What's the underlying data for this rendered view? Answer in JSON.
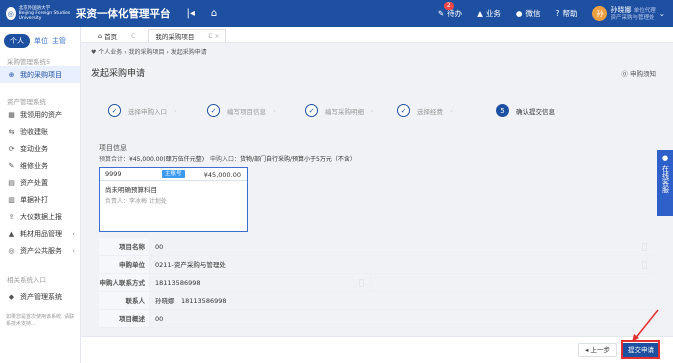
{
  "header": {
    "logo_symbol": "◎",
    "logo_text_cn": "北京外国语大学",
    "logo_text_en": "Beijing Foreign Studies University",
    "app_title": "采资一体化管理平台",
    "collapse_icon": "|◂",
    "home_icon": "home-icon",
    "todo_label": "待办",
    "todo_badge": "2",
    "business_label": "业务",
    "wechat_label": "微信",
    "help_label": "帮助",
    "user_name": "孙晓娜",
    "user_extra": "单位代理",
    "user_dept": "资产采购与管理处",
    "avatar_initial": "孙"
  },
  "sidebar": {
    "role_tabs": [
      "个人",
      "单位",
      "主管"
    ],
    "section1_title": "采购管理系统5",
    "my_purchase": "我的采购项目",
    "section2_title": "资产管理系统",
    "items": [
      {
        "label": "我领用的资产",
        "icon": "▦"
      },
      {
        "label": "验收建账",
        "icon": "⇆"
      },
      {
        "label": "变动业务",
        "icon": "⟳"
      },
      {
        "label": "维修业务",
        "icon": "✎"
      },
      {
        "label": "资产处置",
        "icon": "▤"
      },
      {
        "label": "单据补打",
        "icon": "▥"
      },
      {
        "label": "大仪数据上报",
        "icon": "⇪"
      },
      {
        "label": "耗材用品管理",
        "icon": "▲",
        "caret": "‹"
      },
      {
        "label": "资产公共服务",
        "icon": "◎",
        "caret": "‹"
      }
    ],
    "section3_title": "相关系统入口",
    "related_item": "资产管理系统",
    "note": "如果您是首次使用该系统, 请联系技术支持…"
  },
  "tabs": [
    {
      "label": "首页",
      "ctl": "C"
    },
    {
      "label": "我的采购项目",
      "ctl": "C ×"
    }
  ],
  "breadcrumb": "♥ 个人业务 › 我的采购项目 › 发起采购申请",
  "page_title": "发起采购申请",
  "help_link": "⓪ 申购须知",
  "steps": [
    {
      "num": "✓",
      "label": "选择申购入口"
    },
    {
      "num": "✓",
      "label": "编写项目信息"
    },
    {
      "num": "✓",
      "label": "编写采购明细"
    },
    {
      "num": "✓",
      "label": "选择经费"
    },
    {
      "num": "5",
      "label": "确认提交信息"
    }
  ],
  "project": {
    "title": "项目信息",
    "budget_label": "预算合计：",
    "budget_amount": "¥45,000.00(肆万伍仟元整)",
    "entry_label": "申购入口：",
    "entry_value": "货物/部门自行采购/预算小于5万元（不含）",
    "card_code": "9999",
    "card_tag": "主账号",
    "card_amount": "¥45,000.00",
    "card_name": "尚未明确预算科目",
    "card_owner": "负责人：李冰梅 计划处"
  },
  "info_rows": [
    {
      "label": "项目名称",
      "value": "00"
    },
    {
      "label": "申购单位",
      "value": "0211-资产采购与管理处"
    },
    {
      "label": "申购人联系方式",
      "value": "18113586998"
    },
    {
      "label": "联系人",
      "value": "孙晓娜　18113586998"
    },
    {
      "label": "项目概述",
      "value": "00"
    }
  ],
  "service_text": "在线客服",
  "buttons": {
    "prev": "◂ 上一步",
    "submit": "提交申请"
  }
}
